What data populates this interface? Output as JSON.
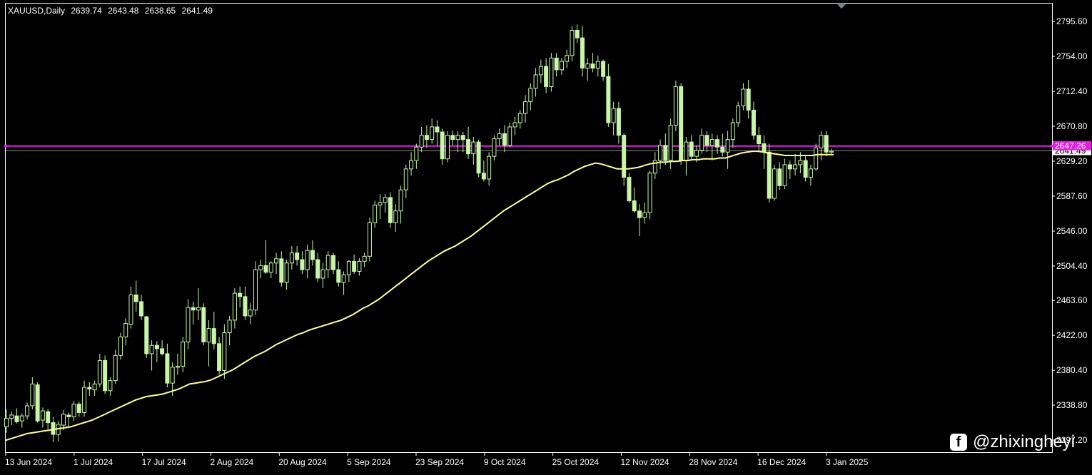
{
  "header": {
    "symbol": "XAUUSD,Daily",
    "open": "2639.74",
    "high": "2643.48",
    "low": "2638.65",
    "close": "2641.49"
  },
  "watermark": {
    "icon": "facebook-icon",
    "text": "@zhixingheyi"
  },
  "colors": {
    "background": "#000000",
    "frame": "#ffffff",
    "candle": "#c8f5a8",
    "moving_average": "#ffff99",
    "h_line": "#e11ee1",
    "price_line": "#8c8c8c"
  },
  "chart_data": {
    "type": "candlestick",
    "symbol": "XAUUSD",
    "timeframe": "Daily",
    "y_ticks": [
      2795.6,
      2754.0,
      2712.4,
      2670.8,
      2629.2,
      2587.6,
      2546.0,
      2504.4,
      2463.6,
      2422.0,
      2380.4,
      2338.8,
      2297.2
    ],
    "y_tick_labels": [
      "2795.60",
      "2754.00",
      "2712.40",
      "2670.80",
      "2629.20",
      "2587.60",
      "2546.00",
      "2504.40",
      "2463.60",
      "2422.00",
      "2380.40",
      "2338.80",
      "2297.20"
    ],
    "x_labels": [
      "13 Jun 2024",
      "1 Jul 2024",
      "17 Jul 2024",
      "2 Aug 2024",
      "20 Aug 2024",
      "5 Sep 2024",
      "23 Sep 2024",
      "9 Oct 2024",
      "25 Oct 2024",
      "12 Nov 2024",
      "28 Nov 2024",
      "16 Dec 2024",
      "3 Jan 2025"
    ],
    "horizontal_line": {
      "value": 2647.26,
      "label": "2647.26"
    },
    "price_line": {
      "value": 2641.49,
      "label": "2641.49"
    },
    "moving_average": [
      2297,
      2299,
      2301,
      2303,
      2305,
      2306,
      2307,
      2308,
      2309,
      2310,
      2311,
      2312,
      2313,
      2315,
      2317,
      2319,
      2321,
      2324,
      2327,
      2330,
      2333,
      2336,
      2339,
      2342,
      2345,
      2347,
      2349,
      2350,
      2351,
      2352,
      2354,
      2356,
      2358,
      2361,
      2364,
      2365,
      2366,
      2367,
      2369,
      2372,
      2375,
      2378,
      2381,
      2385,
      2389,
      2393,
      2397,
      2400,
      2403,
      2407,
      2411,
      2414,
      2417,
      2420,
      2423,
      2425,
      2428,
      2430,
      2432,
      2434,
      2436,
      2438,
      2440,
      2443,
      2446,
      2450,
      2454,
      2457,
      2461,
      2465,
      2470,
      2475,
      2480,
      2485,
      2490,
      2495,
      2500,
      2505,
      2510,
      2514,
      2518,
      2522,
      2525,
      2528,
      2532,
      2536,
      2540,
      2545,
      2550,
      2555,
      2560,
      2565,
      2570,
      2574,
      2578,
      2582,
      2586,
      2590,
      2594,
      2598,
      2602,
      2605,
      2607,
      2610,
      2613,
      2617,
      2620,
      2623,
      2625,
      2627,
      2626,
      2624,
      2622,
      2620,
      2620,
      2620,
      2621,
      2622,
      2624,
      2626,
      2627,
      2628,
      2628,
      2629,
      2629,
      2630,
      2630,
      2631,
      2631,
      2632,
      2632,
      2632,
      2633,
      2633,
      2635,
      2637,
      2639,
      2640,
      2641,
      2641,
      2640,
      2639,
      2638,
      2637,
      2636,
      2636,
      2636,
      2636,
      2636,
      2636,
      2637,
      2637,
      2637,
      2637
    ],
    "candles": [
      [
        2313,
        2334,
        2306,
        2323
      ],
      [
        2323,
        2331,
        2315,
        2327
      ],
      [
        2326,
        2335,
        2317,
        2319
      ],
      [
        2320,
        2329,
        2312,
        2326
      ],
      [
        2326,
        2342,
        2322,
        2338
      ],
      [
        2338,
        2372,
        2334,
        2364
      ],
      [
        2363,
        2366,
        2318,
        2320
      ],
      [
        2321,
        2336,
        2312,
        2332
      ],
      [
        2331,
        2334,
        2310,
        2318
      ],
      [
        2318,
        2325,
        2295,
        2304
      ],
      [
        2304,
        2320,
        2296,
        2316
      ],
      [
        2315,
        2333,
        2309,
        2328
      ],
      [
        2327,
        2330,
        2312,
        2325
      ],
      [
        2325,
        2344,
        2320,
        2340
      ],
      [
        2340,
        2343,
        2325,
        2330
      ],
      [
        2330,
        2368,
        2325,
        2360
      ],
      [
        2360,
        2366,
        2350,
        2358
      ],
      [
        2357,
        2368,
        2350,
        2364
      ],
      [
        2364,
        2400,
        2360,
        2392
      ],
      [
        2392,
        2398,
        2352,
        2356
      ],
      [
        2356,
        2372,
        2350,
        2368
      ],
      [
        2368,
        2405,
        2364,
        2398
      ],
      [
        2398,
        2425,
        2393,
        2420
      ],
      [
        2420,
        2442,
        2410,
        2436
      ],
      [
        2435,
        2480,
        2430,
        2470
      ],
      [
        2470,
        2487,
        2450,
        2462
      ],
      [
        2462,
        2470,
        2440,
        2445
      ],
      [
        2444,
        2445,
        2395,
        2400
      ],
      [
        2400,
        2416,
        2380,
        2410
      ],
      [
        2410,
        2415,
        2390,
        2406
      ],
      [
        2406,
        2416,
        2398,
        2400
      ],
      [
        2400,
        2412,
        2360,
        2365
      ],
      [
        2365,
        2390,
        2350,
        2384
      ],
      [
        2384,
        2400,
        2375,
        2385
      ],
      [
        2385,
        2420,
        2378,
        2414
      ],
      [
        2414,
        2465,
        2405,
        2455
      ],
      [
        2455,
        2462,
        2435,
        2452
      ],
      [
        2452,
        2478,
        2440,
        2455
      ],
      [
        2455,
        2460,
        2410,
        2414
      ],
      [
        2414,
        2440,
        2385,
        2430
      ],
      [
        2430,
        2450,
        2405,
        2412
      ],
      [
        2412,
        2420,
        2375,
        2380
      ],
      [
        2380,
        2435,
        2370,
        2425
      ],
      [
        2425,
        2445,
        2410,
        2440
      ],
      [
        2440,
        2478,
        2430,
        2472
      ],
      [
        2472,
        2480,
        2455,
        2468
      ],
      [
        2468,
        2480,
        2440,
        2445
      ],
      [
        2445,
        2460,
        2435,
        2452
      ],
      [
        2452,
        2510,
        2446,
        2500
      ],
      [
        2500,
        2512,
        2490,
        2505
      ],
      [
        2505,
        2535,
        2495,
        2497
      ],
      [
        2497,
        2510,
        2490,
        2508
      ],
      [
        2508,
        2520,
        2495,
        2513
      ],
      [
        2513,
        2522,
        2480,
        2485
      ],
      [
        2485,
        2512,
        2476,
        2508
      ],
      [
        2508,
        2528,
        2500,
        2520
      ],
      [
        2520,
        2528,
        2505,
        2512
      ],
      [
        2512,
        2522,
        2495,
        2500
      ],
      [
        2500,
        2530,
        2490,
        2523
      ],
      [
        2523,
        2535,
        2505,
        2512
      ],
      [
        2512,
        2520,
        2485,
        2490
      ],
      [
        2490,
        2508,
        2478,
        2500
      ],
      [
        2500,
        2522,
        2490,
        2517
      ],
      [
        2517,
        2520,
        2495,
        2500
      ],
      [
        2500,
        2510,
        2480,
        2485
      ],
      [
        2485,
        2498,
        2470,
        2494
      ],
      [
        2494,
        2512,
        2485,
        2510
      ],
      [
        2510,
        2518,
        2495,
        2498
      ],
      [
        2498,
        2514,
        2493,
        2510
      ],
      [
        2510,
        2520,
        2503,
        2516
      ],
      [
        2516,
        2562,
        2510,
        2556
      ],
      [
        2556,
        2582,
        2550,
        2577
      ],
      [
        2577,
        2590,
        2560,
        2580
      ],
      [
        2580,
        2590,
        2568,
        2586
      ],
      [
        2586,
        2592,
        2550,
        2556
      ],
      [
        2556,
        2578,
        2545,
        2570
      ],
      [
        2570,
        2600,
        2555,
        2595
      ],
      [
        2595,
        2625,
        2585,
        2620
      ],
      [
        2620,
        2640,
        2612,
        2630
      ],
      [
        2630,
        2650,
        2620,
        2646
      ],
      [
        2646,
        2670,
        2640,
        2660
      ],
      [
        2660,
        2672,
        2645,
        2655
      ],
      [
        2655,
        2680,
        2650,
        2670
      ],
      [
        2670,
        2678,
        2648,
        2664
      ],
      [
        2664,
        2668,
        2625,
        2632
      ],
      [
        2632,
        2665,
        2628,
        2660
      ],
      [
        2660,
        2666,
        2648,
        2655
      ],
      [
        2655,
        2665,
        2640,
        2660
      ],
      [
        2660,
        2664,
        2640,
        2655
      ],
      [
        2655,
        2670,
        2632,
        2638
      ],
      [
        2638,
        2658,
        2625,
        2652
      ],
      [
        2652,
        2655,
        2610,
        2615
      ],
      [
        2615,
        2630,
        2605,
        2608
      ],
      [
        2608,
        2640,
        2600,
        2635
      ],
      [
        2635,
        2660,
        2630,
        2656
      ],
      [
        2656,
        2668,
        2648,
        2662
      ],
      [
        2662,
        2672,
        2640,
        2648
      ],
      [
        2648,
        2675,
        2645,
        2670
      ],
      [
        2670,
        2682,
        2660,
        2675
      ],
      [
        2675,
        2690,
        2668,
        2686
      ],
      [
        2686,
        2708,
        2675,
        2700
      ],
      [
        2700,
        2722,
        2690,
        2716
      ],
      [
        2716,
        2740,
        2706,
        2732
      ],
      [
        2732,
        2750,
        2722,
        2742
      ],
      [
        2742,
        2752,
        2710,
        2718
      ],
      [
        2718,
        2758,
        2712,
        2752
      ],
      [
        2752,
        2758,
        2730,
        2738
      ],
      [
        2738,
        2752,
        2732,
        2748
      ],
      [
        2748,
        2762,
        2740,
        2755
      ],
      [
        2755,
        2790,
        2748,
        2785
      ],
      [
        2785,
        2792,
        2770,
        2776
      ],
      [
        2776,
        2790,
        2730,
        2740
      ],
      [
        2740,
        2752,
        2725,
        2745
      ],
      [
        2745,
        2758,
        2735,
        2740
      ],
      [
        2740,
        2755,
        2730,
        2748
      ],
      [
        2748,
        2750,
        2725,
        2730
      ],
      [
        2730,
        2745,
        2670,
        2675
      ],
      [
        2675,
        2700,
        2660,
        2692
      ],
      [
        2692,
        2700,
        2650,
        2660
      ],
      [
        2660,
        2662,
        2600,
        2610
      ],
      [
        2610,
        2615,
        2580,
        2582
      ],
      [
        2582,
        2598,
        2568,
        2570
      ],
      [
        2570,
        2578,
        2540,
        2562
      ],
      [
        2562,
        2580,
        2555,
        2568
      ],
      [
        2568,
        2618,
        2560,
        2615
      ],
      [
        2615,
        2640,
        2608,
        2630
      ],
      [
        2630,
        2655,
        2620,
        2648
      ],
      [
        2648,
        2662,
        2625,
        2630
      ],
      [
        2630,
        2680,
        2620,
        2672
      ],
      [
        2672,
        2725,
        2665,
        2718
      ],
      [
        2718,
        2722,
        2625,
        2630
      ],
      [
        2630,
        2658,
        2612,
        2652
      ],
      [
        2652,
        2660,
        2630,
        2635
      ],
      [
        2635,
        2648,
        2628,
        2642
      ],
      [
        2642,
        2668,
        2638,
        2660
      ],
      [
        2660,
        2665,
        2640,
        2648
      ],
      [
        2648,
        2662,
        2630,
        2655
      ],
      [
        2655,
        2660,
        2638,
        2646
      ],
      [
        2646,
        2662,
        2635,
        2640
      ],
      [
        2640,
        2665,
        2620,
        2655
      ],
      [
        2655,
        2680,
        2645,
        2675
      ],
      [
        2675,
        2700,
        2670,
        2695
      ],
      [
        2695,
        2722,
        2690,
        2715
      ],
      [
        2715,
        2726,
        2680,
        2690
      ],
      [
        2690,
        2700,
        2655,
        2660
      ],
      [
        2660,
        2670,
        2640,
        2650
      ],
      [
        2650,
        2660,
        2620,
        2640
      ],
      [
        2640,
        2650,
        2580,
        2585
      ],
      [
        2585,
        2625,
        2582,
        2620
      ],
      [
        2620,
        2628,
        2595,
        2600
      ],
      [
        2600,
        2632,
        2596,
        2625
      ],
      [
        2625,
        2630,
        2608,
        2620
      ],
      [
        2620,
        2638,
        2612,
        2625
      ],
      [
        2625,
        2640,
        2615,
        2630
      ],
      [
        2630,
        2635,
        2605,
        2610
      ],
      [
        2610,
        2625,
        2600,
        2620
      ],
      [
        2620,
        2650,
        2618,
        2645
      ],
      [
        2645,
        2665,
        2630,
        2660
      ],
      [
        2660,
        2665,
        2635,
        2640
      ],
      [
        2640,
        2644,
        2638,
        2641
      ]
    ]
  }
}
